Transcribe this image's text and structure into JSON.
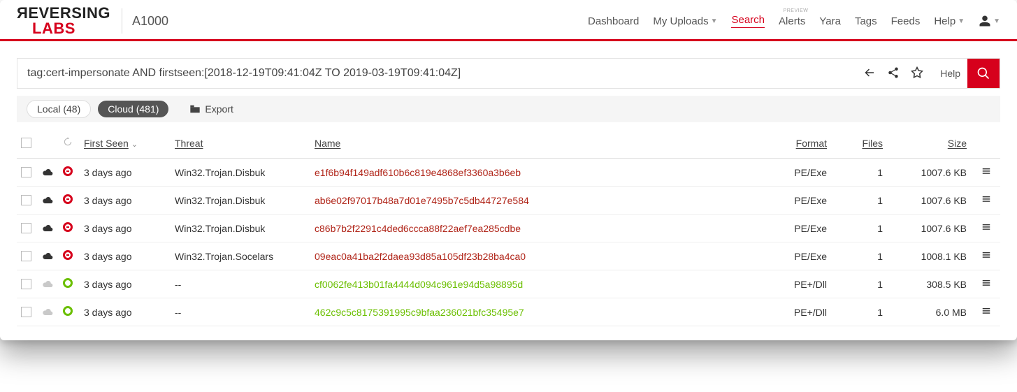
{
  "brand": {
    "line1": "ЯEVERSING",
    "line2": "LABS"
  },
  "product": "A1000",
  "nav": {
    "dashboard": "Dashboard",
    "uploads": "My Uploads",
    "search": "Search",
    "alerts": "Alerts",
    "yara": "Yara",
    "tags": "Tags",
    "feeds": "Feeds",
    "help": "Help",
    "preview_tag": "PREVIEW"
  },
  "search": {
    "query": "tag:cert-impersonate AND firstseen:[2018-12-19T09:41:04Z TO 2019-03-19T09:41:04Z]",
    "help": "Help"
  },
  "tabs": {
    "local": "Local (48)",
    "cloud": "Cloud (481)",
    "export": "Export"
  },
  "columns": {
    "first_seen": "First Seen",
    "threat": "Threat",
    "name": "Name",
    "format": "Format",
    "files": "Files",
    "size": "Size"
  },
  "rows": [
    {
      "cloud": "dark",
      "status": "bad",
      "first_seen": "3 days ago",
      "threat": "Win32.Trojan.Disbuk",
      "name": "e1f6b94f149adf610b6c819e4868ef3360a3b6eb",
      "hash_color": "red",
      "format": "PE/Exe",
      "files": "1",
      "size": "1007.6 KB"
    },
    {
      "cloud": "dark",
      "status": "bad",
      "first_seen": "3 days ago",
      "threat": "Win32.Trojan.Disbuk",
      "name": "ab6e02f97017b48a7d01e7495b7c5db44727e584",
      "hash_color": "red",
      "format": "PE/Exe",
      "files": "1",
      "size": "1007.6 KB"
    },
    {
      "cloud": "dark",
      "status": "bad",
      "first_seen": "3 days ago",
      "threat": "Win32.Trojan.Disbuk",
      "name": "c86b7b2f2291c4ded6ccca88f22aef7ea285cdbe",
      "hash_color": "red",
      "format": "PE/Exe",
      "files": "1",
      "size": "1007.6 KB"
    },
    {
      "cloud": "dark",
      "status": "bad",
      "first_seen": "3 days ago",
      "threat": "Win32.Trojan.Socelars",
      "name": "09eac0a41ba2f2daea93d85a105df23b28ba4ca0",
      "hash_color": "red",
      "format": "PE/Exe",
      "files": "1",
      "size": "1008.1 KB"
    },
    {
      "cloud": "light",
      "status": "good",
      "first_seen": "3 days ago",
      "threat": "--",
      "name": "cf0062fe413b01fa4444d094c961e94d5a98895d",
      "hash_color": "green",
      "format": "PE+/Dll",
      "files": "1",
      "size": "308.5 KB"
    },
    {
      "cloud": "light",
      "status": "good",
      "first_seen": "3 days ago",
      "threat": "--",
      "name": "462c9c5c8175391995c9bfaa236021bfc35495e7",
      "hash_color": "green",
      "format": "PE+/Dll",
      "files": "1",
      "size": "6.0 MB"
    }
  ]
}
